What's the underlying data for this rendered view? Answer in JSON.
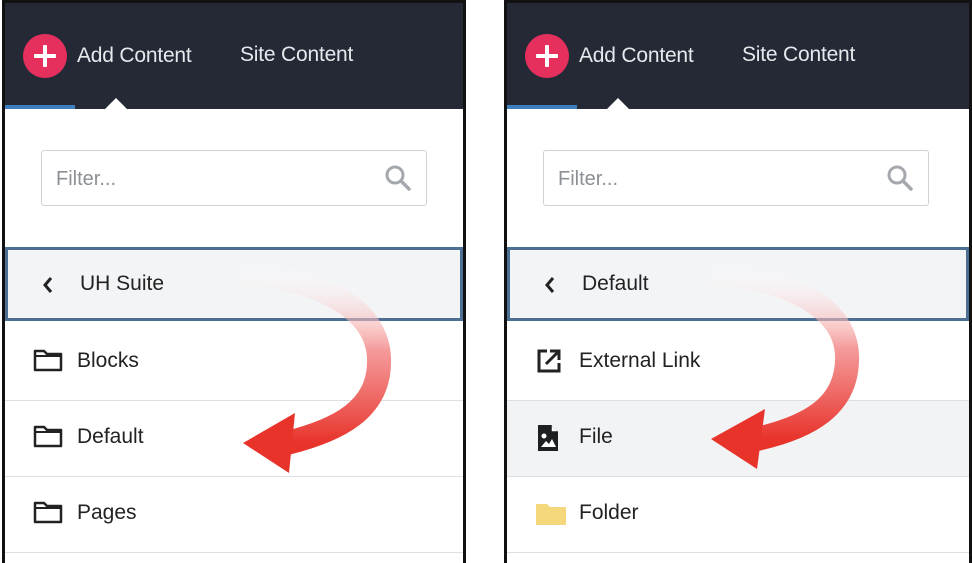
{
  "panels": [
    {
      "header": {
        "add_label": "Add Content",
        "site_label": "Site Content"
      },
      "filter": {
        "placeholder": "Filter..."
      },
      "back_label": "UH Suite",
      "items": [
        {
          "label": "Blocks",
          "icon": "folder-icon"
        },
        {
          "label": "Default",
          "icon": "folder-icon"
        },
        {
          "label": "Pages",
          "icon": "folder-icon"
        }
      ]
    },
    {
      "header": {
        "add_label": "Add Content",
        "site_label": "Site Content"
      },
      "filter": {
        "placeholder": "Filter..."
      },
      "back_label": "Default",
      "items": [
        {
          "label": "External Link",
          "icon": "external-link-icon"
        },
        {
          "label": "File",
          "icon": "file-image-icon"
        },
        {
          "label": "Folder",
          "icon": "folder-yellow-icon"
        }
      ]
    }
  ],
  "colors": {
    "topbar": "#242935",
    "add_button": "#e5305d",
    "selected_border": "#4d6f94",
    "annotation_arrow": "#e8332b",
    "folder_yellow": "#f5d77c"
  }
}
